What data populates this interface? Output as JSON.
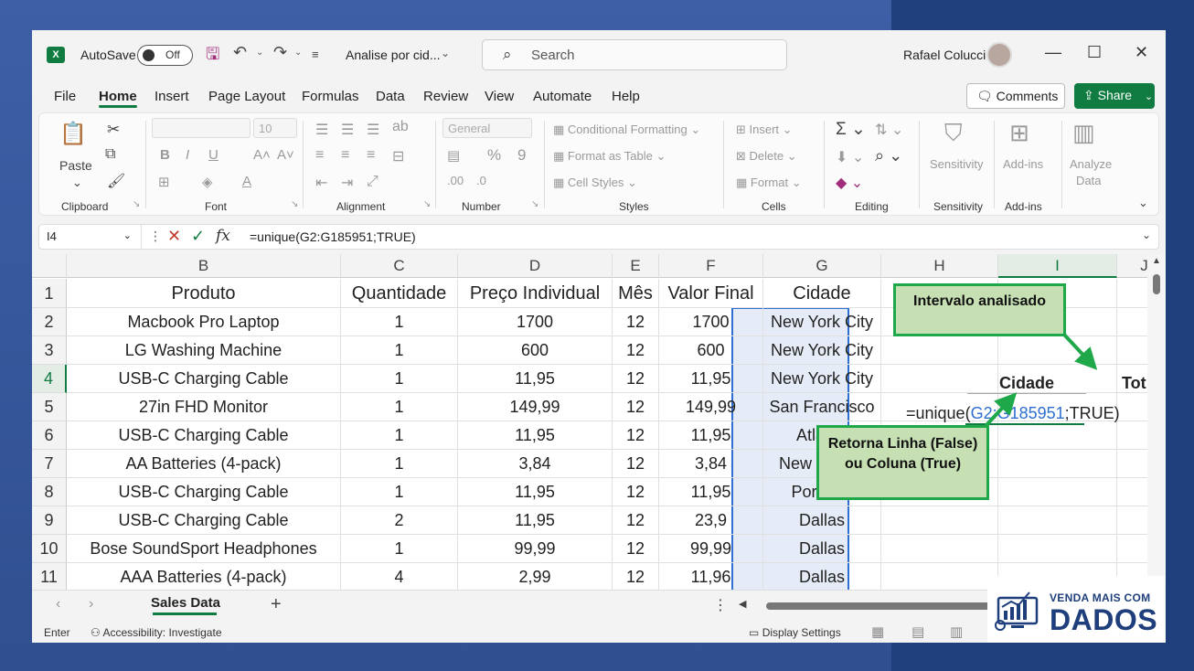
{
  "titlebar": {
    "autosave_label": "AutoSave",
    "autosave_state": "Off",
    "doc_title": "Analise por cid...",
    "search_placeholder": "Search",
    "user_name": "Rafael Colucci"
  },
  "ribbon_tabs": [
    "File",
    "Home",
    "Insert",
    "Page Layout",
    "Formulas",
    "Data",
    "Review",
    "View",
    "Automate",
    "Help"
  ],
  "comments_label": "Comments",
  "share_label": "Share",
  "ribbon": {
    "clipboard": {
      "paste": "Paste",
      "label": "Clipboard"
    },
    "font": {
      "size": "10",
      "label": "Font"
    },
    "alignment": {
      "label": "Alignment"
    },
    "number": {
      "format": "General",
      "label": "Number"
    },
    "styles": {
      "conditional": "Conditional Formatting",
      "format_table": "Format as Table",
      "cell_styles": "Cell Styles",
      "label": "Styles"
    },
    "cells": {
      "insert": "Insert",
      "delete": "Delete",
      "format": "Format",
      "label": "Cells"
    },
    "editing": {
      "label": "Editing"
    },
    "sensitivity": {
      "btn": "Sensitivity",
      "label": "Sensitivity"
    },
    "addins": {
      "btn": "Add-ins",
      "label": "Add-ins"
    },
    "analyze": {
      "btn1": "Analyze",
      "btn2": "Data"
    }
  },
  "formula_bar": {
    "name_box": "I4",
    "formula": "=unique(G2:G185951;TRUE)"
  },
  "columns": [
    "B",
    "C",
    "D",
    "E",
    "F",
    "G",
    "H",
    "I",
    "J"
  ],
  "rows": [
    "1",
    "2",
    "3",
    "4",
    "5",
    "6",
    "7",
    "8",
    "9",
    "10",
    "11"
  ],
  "table": {
    "headers": [
      "Produto",
      "Quantidade",
      "Preço Individual",
      "Mês",
      "Valor Final",
      "Cidade"
    ],
    "rows": [
      [
        "Macbook Pro Laptop",
        "1",
        "1700",
        "12",
        "1700",
        "New York City"
      ],
      [
        "LG Washing Machine",
        "1",
        "600",
        "12",
        "600",
        "New York City"
      ],
      [
        "USB-C Charging Cable",
        "1",
        "11,95",
        "12",
        "11,95",
        "New York City"
      ],
      [
        "27in FHD Monitor",
        "1",
        "149,99",
        "12",
        "149,99",
        "San Francisco"
      ],
      [
        "USB-C Charging Cable",
        "1",
        "11,95",
        "12",
        "11,95",
        "Atlanta"
      ],
      [
        "AA Batteries (4-pack)",
        "1",
        "3,84",
        "12",
        "3,84",
        "New York C"
      ],
      [
        "USB-C Charging Cable",
        "1",
        "11,95",
        "12",
        "11,95",
        "Portland"
      ],
      [
        "USB-C Charging Cable",
        "2",
        "11,95",
        "12",
        "23,9",
        "Dallas"
      ],
      [
        "Bose SoundSport Headphones",
        "1",
        "99,99",
        "12",
        "99,99",
        "Dallas"
      ],
      [
        "AAA Batteries (4-pack)",
        "4",
        "2,99",
        "12",
        "11,96",
        "Dallas"
      ]
    ]
  },
  "side": {
    "cidade_header": "Cidade",
    "tot_header": "Tot",
    "formula_prefix": "=unique(",
    "formula_ref": "G2:G185951",
    "formula_suffix": ";TRUE)"
  },
  "callouts": {
    "intervalo": "Intervalo analisado",
    "retorna": "Retorna Linha (False) ou Coluna (True)"
  },
  "sheet_tab": "Sales Data",
  "status": {
    "mode": "Enter",
    "accessibility": "Accessibility: Investigate",
    "display": "Display Settings"
  },
  "brand": {
    "line1": "VENDA MAIS COM",
    "line2": "DADOS"
  },
  "colors": {
    "excel_green": "#107c41",
    "selection_blue": "#2f6fd1",
    "callout_fill": "#c6e0b4",
    "callout_border": "#1fa84a",
    "brand_navy": "#1f3f7c"
  }
}
